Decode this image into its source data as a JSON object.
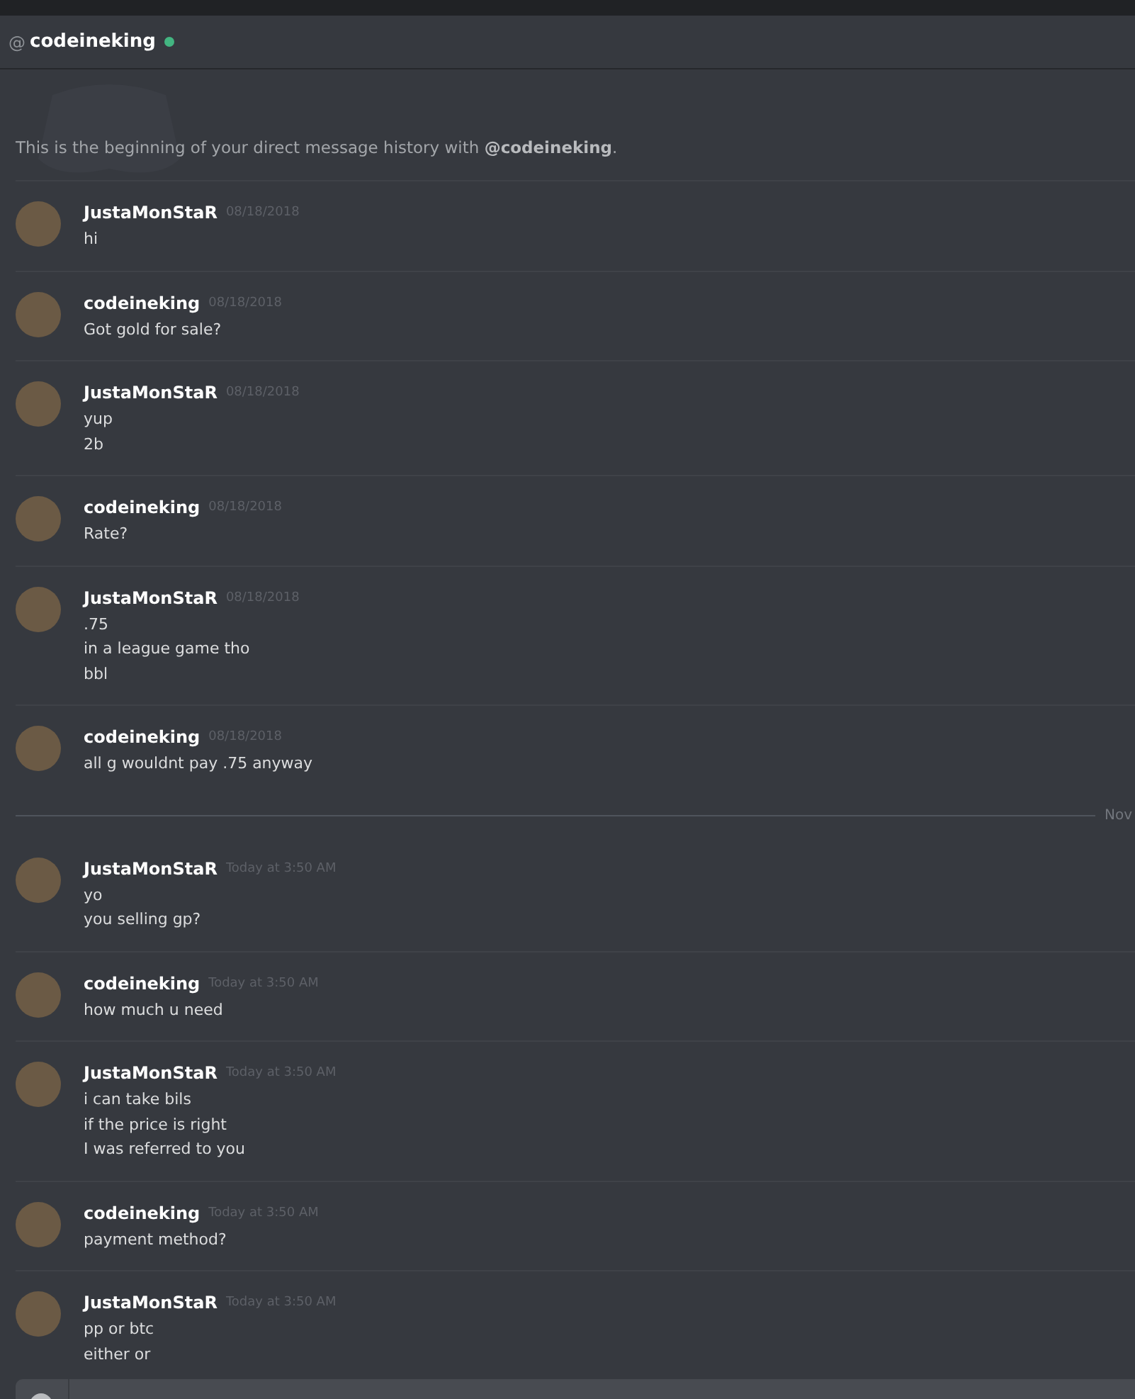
{
  "header": {
    "at_sign": "@",
    "username": "codeineking",
    "online": true
  },
  "intro": {
    "text": "This is the beginning of your direct message history with **@codeineking**."
  },
  "messages": [
    {
      "kind": "group",
      "author": "JustaMonStaR",
      "timestamp": "08/18/2018",
      "lines": [
        "hi"
      ]
    },
    {
      "kind": "group",
      "author": "codeineking",
      "timestamp": "08/18/2018",
      "lines": [
        "Got gold for sale?"
      ]
    },
    {
      "kind": "group",
      "author": "JustaMonStaR",
      "timestamp": "08/18/2018",
      "lines": [
        "yup",
        "2b"
      ]
    },
    {
      "kind": "group",
      "author": "codeineking",
      "timestamp": "08/18/2018",
      "lines": [
        "Rate?"
      ]
    },
    {
      "kind": "group",
      "author": "JustaMonStaR",
      "timestamp": "08/18/2018",
      "lines": [
        ".75",
        "in a league game tho",
        "bbl"
      ]
    },
    {
      "kind": "group",
      "author": "codeineking",
      "timestamp": "08/18/2018",
      "lines": [
        "all g wouldnt pay .75 anyway"
      ]
    },
    {
      "kind": "divider",
      "label": "Nov"
    },
    {
      "kind": "group",
      "author": "JustaMonStaR",
      "timestamp": "Today at 3:50 AM",
      "lines": [
        "yo",
        "you selling gp?"
      ]
    },
    {
      "kind": "group",
      "author": "codeineking",
      "timestamp": "Today at 3:50 AM",
      "lines": [
        "how much u need"
      ]
    },
    {
      "kind": "group",
      "author": "JustaMonStaR",
      "timestamp": "Today at 3:50 AM",
      "lines": [
        "i can take bils",
        "if the price is right",
        "I was referred to you"
      ]
    },
    {
      "kind": "group",
      "author": "codeineking",
      "timestamp": "Today at 3:50 AM",
      "lines": [
        "payment method?"
      ]
    },
    {
      "kind": "group",
      "author": "JustaMonStaR",
      "timestamp": "Today at 3:50 AM",
      "lines": [
        "pp or btc",
        "either or"
      ]
    }
  ]
}
